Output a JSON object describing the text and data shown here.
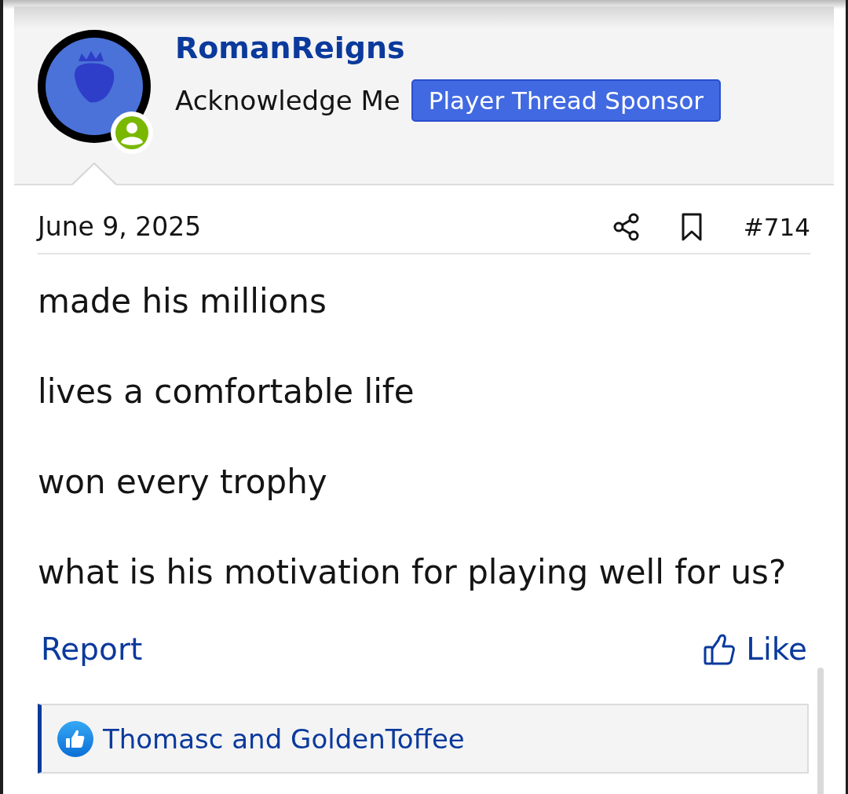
{
  "author": {
    "name": "RomanReigns",
    "title": "Acknowledge Me",
    "banner": "Player Thread Sponsor",
    "online": true
  },
  "post": {
    "date": "June 9, 2025",
    "number": "#714",
    "paragraphs": [
      "made his millions",
      "lives a comfortable life",
      "won every trophy",
      "what is his motivation for playing well for us?"
    ]
  },
  "actions": {
    "report": "Report",
    "like": "Like"
  },
  "reactions": {
    "text": "Thomasc and GoldenToffee"
  }
}
